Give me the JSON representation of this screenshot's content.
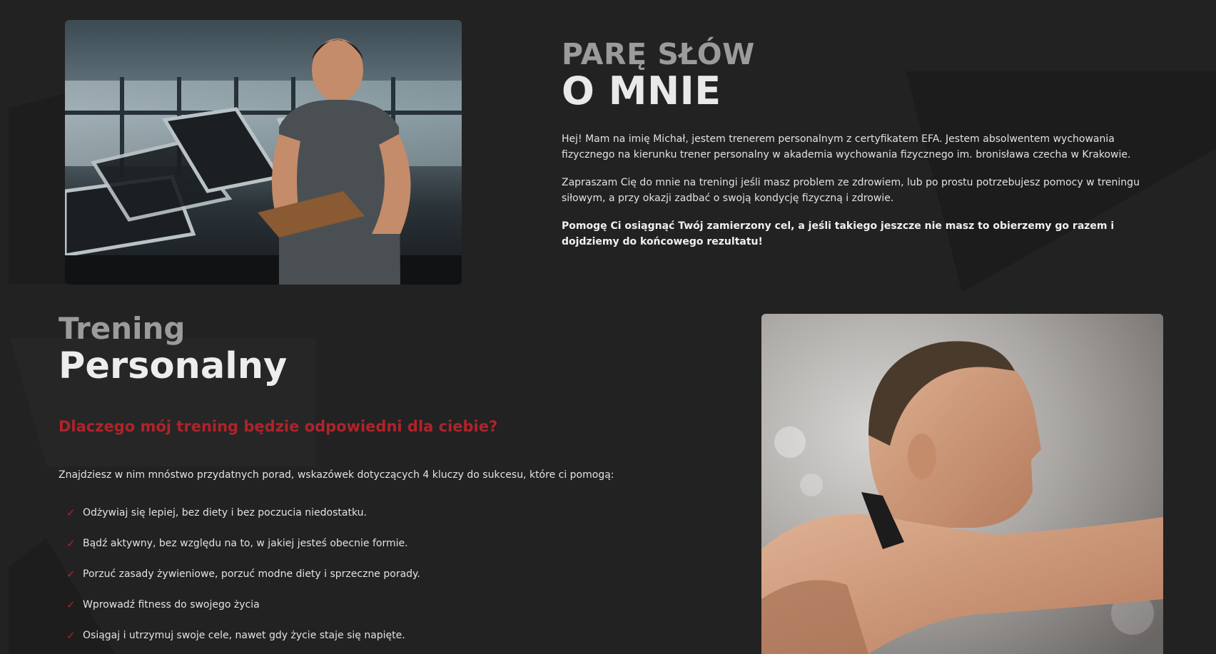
{
  "about": {
    "kicker": "PARĘ SŁÓW",
    "title": "O MNIE",
    "paragraphs": [
      "Hej! Mam na imię Michał, jestem trenerem personalnym z certyfikatem EFA. Jestem absolwentem wychowania fizycznego na kierunku trener personalny w akademia wychowania fizycznego im. bronisława czecha w Krakowie.",
      "Zapraszam Cię do mnie na treningi jeśli masz problem ze zdrowiem, lub po prostu potrzebujesz pomocy w treningu siłowym, a przy okazji zadbać o swoją kondycję fizyczną i zdrowie.",
      "Pomogę Ci osiągnąć Twój zamierzony cel, a jeśli takiego jeszcze nie masz to obierzemy go razem i dojdziemy do końcowego rezultatu!"
    ]
  },
  "training": {
    "kicker": "Trening",
    "title": "Personalny",
    "subtitle": "Dlaczego mój trening będzie odpowiedni dla ciebie?",
    "intro": "Znajdziesz w nim mnóstwo przydatnych porad, wskazówek dotyczących 4 kluczy do sukcesu, które ci pomogą:",
    "check_glyph": "✓",
    "benefits": [
      "Odżywiaj się lepiej, bez diety i bez poczucia niedostatku.",
      "Bądź aktywny, bez względu na to, w jakiej jesteś obecnie formie.",
      "Porzuć zasady żywieniowe, porzuć modne diety i sprzeczne porady.",
      "Wprowadź fitness do swojego życia",
      "Osiągaj i utrzymuj swoje cele, nawet gdy życie staje się napięte."
    ]
  },
  "colors": {
    "background": "#222222",
    "accent": "#b0232a",
    "kicker": "#9b9b9b"
  },
  "images": {
    "trainer": "trainer-photo",
    "athlete": "athlete-photo"
  }
}
